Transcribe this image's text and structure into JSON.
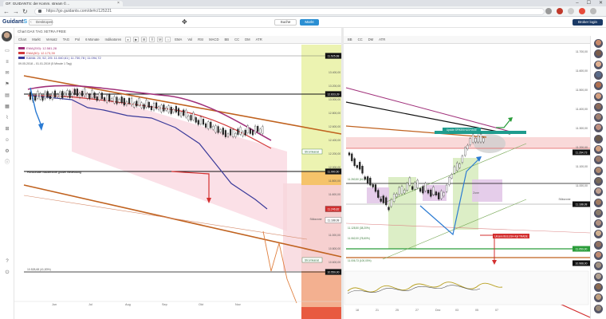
{
  "browser": {
    "tab_title": "GF: GUIDANTS: der Komm. stream ©…",
    "url": "https://go.guidants.com/de#c/125221",
    "window_controls": [
      "–",
      "☐",
      "✕"
    ]
  },
  "header": {
    "logo_main": "Guidant",
    "logo_accent": "S",
    "back_label": "Desktopen",
    "search_label": "Suche",
    "market_label": "Markt",
    "broker_label": "Broker login"
  },
  "left_chart": {
    "window_title": "Chart DAX TAG XETRA FREE",
    "toolbar": [
      "Chart",
      "Markt",
      "Versatz",
      "TAG",
      "Pol",
      "6 Monate",
      "Indikatoren",
      "▸",
      "▶",
      "⊞",
      "‖",
      "M",
      "⌂",
      "EMA",
      "Vol",
      "RSI",
      "MACD",
      "BB",
      "CC",
      "DM",
      "ATR"
    ],
    "legend": [
      {
        "text": "EMA(200): 12.581,28",
        "color": "#a0307a"
      },
      {
        "text": "EMA(50): 12.173,39",
        "color": "#d33b3b"
      },
      {
        "text": "KAMA: 20, 52, 2/5: 11.040,61 | 11.730,78 | 11.094,72",
        "color": "#3a3a9a"
      }
    ],
    "subtitle": "09.05.2018 – 01.01.2019  (5 Minute 1 Tag)",
    "annotations": [
      {
        "text": "Stromkanal",
        "color": "#2f6e3a"
      },
      {
        "text": "Horizontale Nackenlinie großer Bedeutung",
        "color": "#000"
      },
      {
        "text": "Stützzone",
        "color": "#555"
      },
      {
        "text": "Stromkanal",
        "color": "#2f6e3a"
      }
    ],
    "price_tags": [
      "11.525,68",
      "12.833,39",
      "11.990,50",
      "11.246,82",
      "11.188,08",
      "10.550,00"
    ],
    "axis_prices": [
      "13.400,00",
      "13.200,00",
      "13.000,00",
      "12.800,00",
      "12.600,00",
      "12.400,00",
      "12.200,00",
      "12.000,00",
      "11.800,00",
      "11.600,00",
      "11.400,00",
      "11.200,00",
      "11.000,00",
      "10.800,00",
      "10.600,00"
    ],
    "months": [
      "Jun",
      "Jul",
      "Aug",
      "Sep",
      "Okt",
      "Nov"
    ],
    "low_label": "10.528,68 (41,83%)"
  },
  "right_chart": {
    "toolbar": [
      "BB",
      "CC",
      "DM",
      "ATR"
    ],
    "price_tags": [
      "11.264,73",
      "11.188,08",
      "11.050,00",
      "10.988,00"
    ],
    "axis_prices": [
      "11.700,00",
      "11.600,00",
      "11.500,00",
      "11.400,00",
      "11.300,00",
      "11.200,00",
      "11.100,00",
      "11.000,00"
    ],
    "labels": [
      {
        "text": "Zone",
        "color": "#5a5a5a"
      },
      {
        "text": "Zone",
        "color": "#5a5a5a"
      },
      {
        "text": "Zone",
        "color": "#5a5a5a"
      },
      {
        "text": "Upside SPIKEKHLE/HASE",
        "color": "#fff"
      },
      {
        "text": "Unsere BULLISH-Kyl TRADE",
        "color": "#fff"
      },
      {
        "text": "Stützzone",
        "color": "#555"
      }
    ],
    "fib_labels": [
      "11.260,50 (61,80%)",
      "11.128,50 (38,20%)",
      "11.062,00 (78,60%)",
      "11.006,73 (100,00%)"
    ],
    "date_labels": [
      "18",
      "21",
      "25",
      "27",
      "Dez",
      "03",
      "05",
      "07"
    ]
  },
  "colors": {
    "accent": "#2b8fd3",
    "channel_brown": "#c0621f",
    "ema200": "#a0307a",
    "ema50": "#d33b3b",
    "kama": "#3a3a9a",
    "resistance_teal": "#1f9c8e"
  }
}
